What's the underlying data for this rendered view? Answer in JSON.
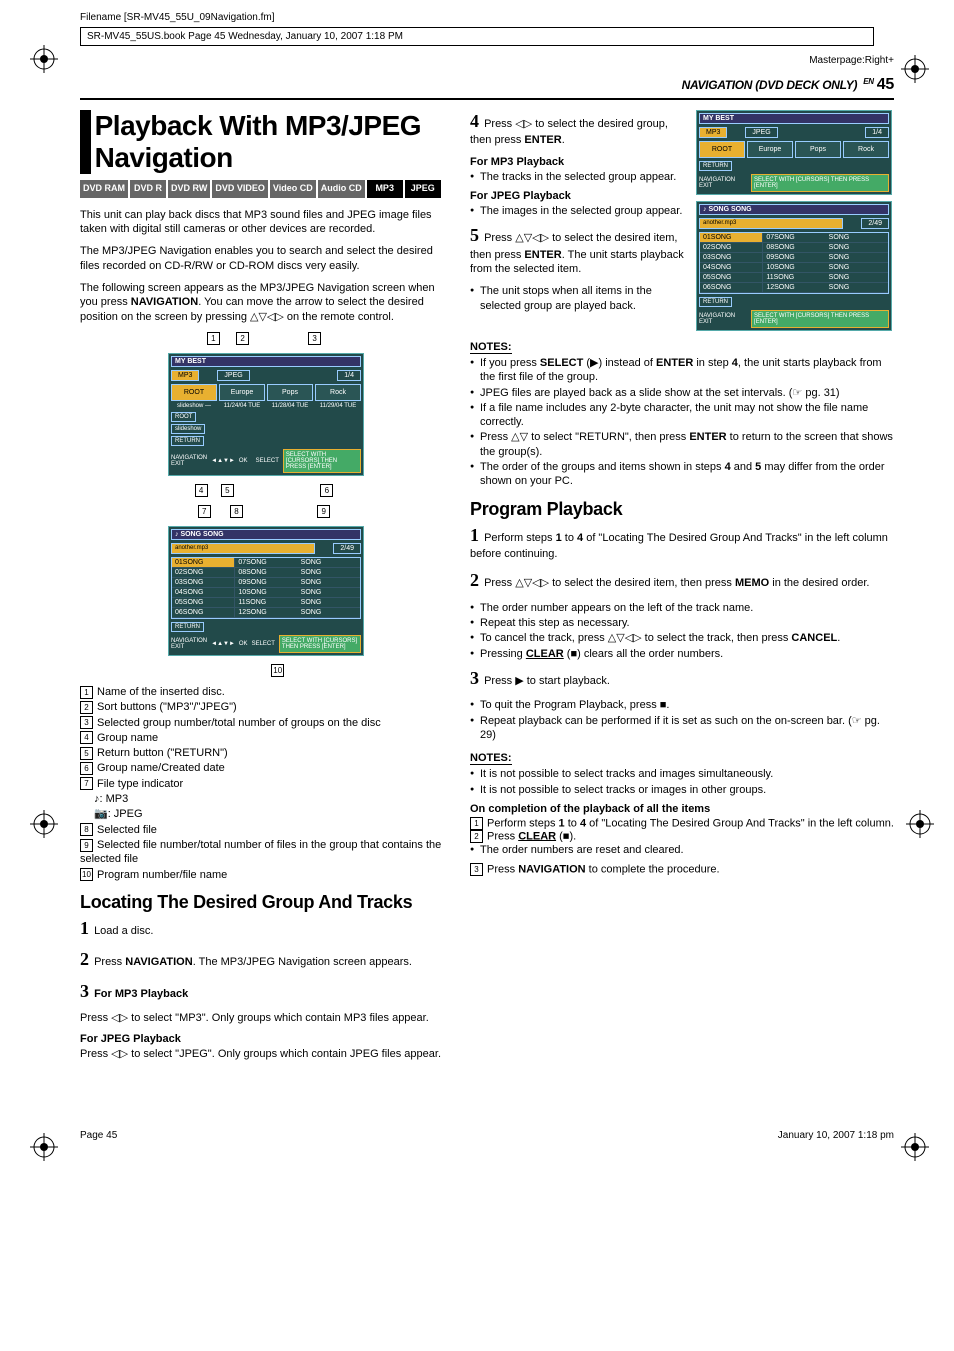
{
  "meta": {
    "filename": "Filename [SR-MV45_55U_09Navigation.fm]",
    "bookline": "SR-MV45_55US.book  Page 45  Wednesday, January 10, 2007  1:18 PM",
    "masterpage": "Masterpage:Right+"
  },
  "header": {
    "section": "NAVIGATION (DVD DECK ONLY)",
    "en": "EN",
    "page": "45"
  },
  "title": "Playback With MP3/JPEG Navigation",
  "badges": [
    "DVD RAM",
    "DVD R",
    "DVD RW",
    "DVD VIDEO",
    "Video CD",
    "Audio CD",
    "MP3",
    "JPEG"
  ],
  "intro1": "This unit can play back discs that MP3 sound files and JPEG image files taken with digital still cameras or other devices are recorded.",
  "intro2": "The MP3/JPEG Navigation enables you to search and select the desired files recorded on CD-R/RW or CD-ROM discs very easily.",
  "intro3a": "The following screen appears as the MP3/JPEG Navigation screen when you press ",
  "intro3nav": "NAVIGATION",
  "intro3b": ". You can move the arrow to select the desired position on the screen by pressing △▽◁▷ on the remote control.",
  "osd1": {
    "title": "MY BEST",
    "tabs": [
      "MP3",
      "JPEG"
    ],
    "page": "1/4",
    "cells": [
      "ROOT",
      "Europe",
      "Pops",
      "Rock"
    ],
    "dates": [
      "slideshow —",
      "11/24/04 TUE",
      "11/28/04 TUE",
      "11/29/04 TUE"
    ],
    "root": "ROOT",
    "slide": "slideshow",
    "return": "RETURN",
    "nav": "NAVIGATION EXIT",
    "hint": "SELECT WITH [CURSORS] THEN PRESS [ENTER]",
    "ok": "OK",
    "sel": "SELECT"
  },
  "osd2": {
    "title": "♪ SONG SONG",
    "file": "another.mp3",
    "page": "2/49",
    "rows": [
      [
        "01SONG",
        "07SONG",
        "SONG"
      ],
      [
        "02SONG",
        "08SONG",
        "SONG"
      ],
      [
        "03SONG",
        "09SONG",
        "SONG"
      ],
      [
        "04SONG",
        "10SONG",
        "SONG"
      ],
      [
        "05SONG",
        "11SONG",
        "SONG"
      ],
      [
        "06SONG",
        "12SONG",
        "SONG"
      ]
    ],
    "return": "RETURN",
    "nav": "NAVIGATION EXIT",
    "hint": "SELECT WITH [CURSORS] THEN PRESS [ENTER]",
    "ok": "OK",
    "sel": "SELECT"
  },
  "legend": {
    "1": "Name of the inserted disc.",
    "2": "Sort buttons (\"MP3\"/\"JPEG\")",
    "3": "Selected group number/total number of groups on the disc",
    "4": "Group name",
    "5": "Return button (\"RETURN\")",
    "6": "Group name/Created date",
    "7": "File type indicator",
    "7a": "♪:   MP3",
    "7b": "📷:  JPEG",
    "8": "Selected file",
    "9": "Selected file number/total number of files in the group that contains the selected file",
    "10": "Program number/file name"
  },
  "locating": {
    "heading": "Locating The Desired Group And Tracks",
    "s1": "Load a disc.",
    "s2a": "Press ",
    "s2nav": "NAVIGATION",
    "s2b": ". The MP3/JPEG Navigation screen appears.",
    "s3h": "For MP3 Playback",
    "s3": "Press ◁▷ to select \"MP3\". Only groups which contain MP3 files appear.",
    "s3jh": "For JPEG Playback",
    "s3j": "Press ◁▷ to select \"JPEG\". Only groups which contain JPEG files appear."
  },
  "right": {
    "s4a": "Press ◁▷ to select the desired group, then press ",
    "s4e": "ENTER",
    "s4b": ".",
    "mp3h": "For MP3 Playback",
    "mp3": "The tracks in the selected group appear.",
    "jpgh": "For JPEG Playback",
    "jpg": "The images in the selected group appear.",
    "s5a": "Press △▽◁▷ to select the desired item, then press ",
    "s5e": "ENTER",
    "s5b": ". The unit starts playback from the selected item.",
    "s5bul": "The unit stops when all items in the selected group are played back.",
    "notes": "NOTES:",
    "n1a": "If you press ",
    "n1s": "SELECT",
    "n1b": " (▶) instead of ",
    "n1e": "ENTER",
    "n1c": " in step ",
    "n1d": "4",
    "n1f": ", the unit starts playback from the first file of the group.",
    "n2": "JPEG files are played back as a slide show at the set intervals. (☞ pg. 31)",
    "n3": "If a file name includes any 2-byte character, the unit may not show the file name correctly.",
    "n4a": "Press △▽ to select \"RETURN\", then press ",
    "n4e": "ENTER",
    "n4b": " to return to the screen that shows the group(s).",
    "n5a": "The order of the groups and items shown in steps ",
    "n5b": "4",
    "n5c": " and ",
    "n5d": "5",
    "n5e": " may differ from the order shown on your PC."
  },
  "program": {
    "heading": "Program Playback",
    "s1a": "Perform steps ",
    "s1b": "1",
    "s1c": " to ",
    "s1d": "4",
    "s1e": " of \"Locating The Desired Group And Tracks\" in the left column before continuing.",
    "s2a": "Press △▽◁▷ to select the desired item, then press ",
    "s2m": "MEMO",
    "s2b": " in the desired order.",
    "b1": "The order number appears on the left of the track name.",
    "b2": "Repeat this step as necessary.",
    "b3a": "To cancel the track, press △▽◁▷ to select the track, then press ",
    "b3c": "CANCEL",
    "b3b": ".",
    "b4a": "Pressing ",
    "b4c": "CLEAR",
    "b4b": " (■) clears all the order numbers.",
    "s3": "Press ▶ to start playback.",
    "b5": "To quit the Program Playback, press ■.",
    "b6": "Repeat playback can be performed if it is set as such on the on-screen bar. (☞ pg. 29)",
    "notes": "NOTES:",
    "n1": "It is not possible to select tracks and images simultaneously.",
    "n2": "It is not possible to select tracks or images in other groups.",
    "comph": "On completion of the playback of all the items",
    "c1a": "Perform steps ",
    "c1b": "1",
    "c1c": " to ",
    "c1d": "4",
    "c1e": " of \"Locating The Desired Group And Tracks\" in the left column.",
    "c2a": "Press ",
    "c2c": "CLEAR",
    "c2b": " (■).",
    "c2bul": "The order numbers are reset and cleared.",
    "c3a": "Press ",
    "c3n": "NAVIGATION",
    "c3b": " to complete the procedure."
  },
  "footer": {
    "left": "Page 45",
    "right": "January 10, 2007 1:18 pm"
  }
}
